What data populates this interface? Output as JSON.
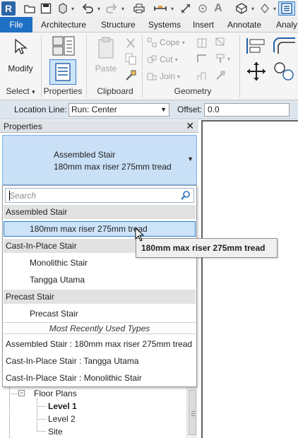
{
  "tabs": [
    "File",
    "Architecture",
    "Structure",
    "Systems",
    "Insert",
    "Annotate",
    "Analy"
  ],
  "ribbon": {
    "modify_label": "Modify",
    "select_label": "Select",
    "properties_label": "Properties",
    "paste_label": "Paste",
    "clipboard_label": "Clipboard",
    "geometry_label": "Geometry",
    "cope_label": "Cope",
    "cut_label": "Cut",
    "join_label": "Join"
  },
  "options_bar": {
    "location_line_label": "Location Line:",
    "location_line_value": "Run: Center",
    "offset_label": "Offset:",
    "offset_value": "0.0"
  },
  "properties": {
    "title": "Properties",
    "close_glyph": "✕",
    "type_family": "Assembled Stair",
    "type_name": "180mm max riser 275mm tread"
  },
  "type_dropdown": {
    "search_placeholder": "Search",
    "groups": [
      {
        "name": "Assembled Stair",
        "items": [
          "180mm max riser 275mm tread"
        ]
      },
      {
        "name": "Cast-In-Place Stair",
        "items": [
          "Monolithic Stair",
          "Tangga Utama"
        ]
      },
      {
        "name": "Precast Stair",
        "items": [
          "Precast Stair"
        ]
      }
    ],
    "selected_item": "180mm max riser 275mm tread",
    "mru_header": "Most Recently Used Types",
    "mru_items": [
      "Assembled Stair : 180mm max riser 275mm tread",
      "Cast-In-Place Stair : Tangga Utama",
      "Cast-In-Place Stair : Monolithic Stair"
    ]
  },
  "tooltip": "180mm max riser 275mm tread",
  "project_browser": {
    "floor_plans_label": "Floor Plans",
    "levels": [
      "Level 1",
      "Level 2",
      "Site"
    ],
    "active_level": "Level 1"
  },
  "colors": {
    "file_tab": "#1f6fc5",
    "selection_fill": "#cce3f8",
    "selection_border": "#2a7bd3",
    "options_bar": "#dde6ef"
  }
}
